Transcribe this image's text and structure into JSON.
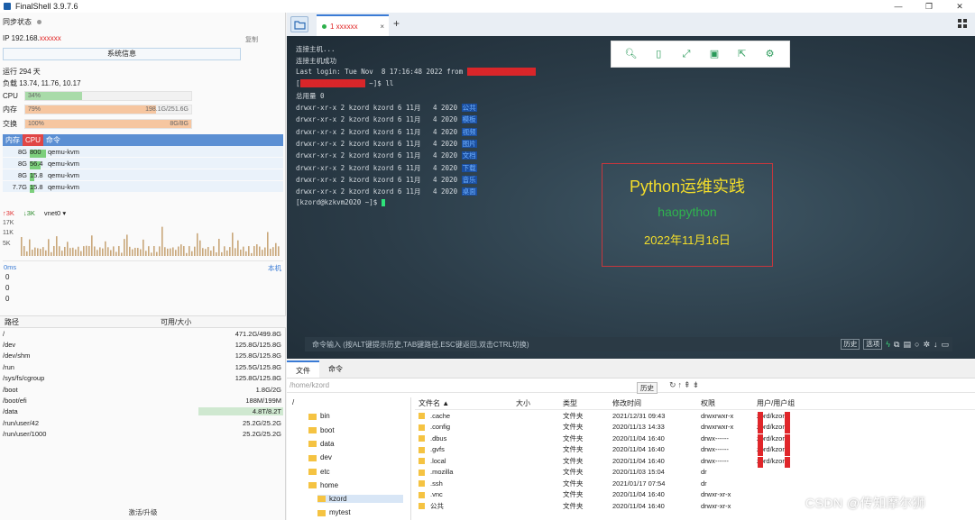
{
  "app": {
    "title": "FinalShell 3.9.7.6",
    "window_buttons": [
      "—",
      "❐",
      "✕"
    ]
  },
  "left": {
    "sync_label": "同步状态",
    "ip_prefix": "IP 192.168.",
    "ip_redacted": "xxxxxx",
    "copy_label": "复制",
    "sysinfo_label": "系统信息",
    "uptime": "运行 294 天",
    "load": "负载 13.74, 11.76, 10.17",
    "cpu": {
      "label": "CPU",
      "pct": "34%",
      "fraction": 0.34,
      "value": "",
      "color": "#a9dba9"
    },
    "mem": {
      "label": "内存",
      "pct": "79%",
      "fraction": 0.79,
      "value": "198.1G/251.6G",
      "color": "#f6c6a0"
    },
    "swap": {
      "label": "交换",
      "pct": "100%",
      "fraction": 1.0,
      "value": "8G/8G",
      "color": "#f6c6a0"
    },
    "proc_header": {
      "mem": "内存",
      "cpu": "CPU",
      "cmd": "命令"
    },
    "processes": [
      {
        "mem": "8G",
        "cpu": "800",
        "cpu_fraction": 1.0,
        "cmd": "qemu-kvm"
      },
      {
        "mem": "8G",
        "cpu": "56.4",
        "cpu_fraction": 0.65,
        "cmd": "qemu-kvm"
      },
      {
        "mem": "8G",
        "cpu": "15.8",
        "cpu_fraction": 0.3,
        "cmd": "qemu-kvm"
      },
      {
        "mem": "7.7G",
        "cpu": "15.8",
        "cpu_fraction": 0.3,
        "cmd": "qemu-kvm"
      }
    ],
    "net": {
      "up": "3K",
      "down": "3K",
      "iface": "vnet0",
      "y_labels": [
        "17K",
        "11K",
        "5K"
      ]
    },
    "ping": {
      "ms_label": "0ms",
      "local_label": "本机",
      "values": [
        "0",
        "0",
        "0"
      ]
    },
    "disk_header": {
      "path": "路径",
      "size": "可用/大小"
    },
    "disks": [
      {
        "path": "/",
        "size": "471.2G/499.8G",
        "hl": false
      },
      {
        "path": "/dev",
        "size": "125.8G/125.8G",
        "hl": false
      },
      {
        "path": "/dev/shm",
        "size": "125.8G/125.8G",
        "hl": false
      },
      {
        "path": "/run",
        "size": "125.5G/125.8G",
        "hl": false
      },
      {
        "path": "/sys/fs/cgroup",
        "size": "125.8G/125.8G",
        "hl": false
      },
      {
        "path": "/boot",
        "size": "1.8G/2G",
        "hl": false
      },
      {
        "path": "/boot/efi",
        "size": "188M/199M",
        "hl": false
      },
      {
        "path": "/data",
        "size": "4.8T/8.2T",
        "hl": true
      },
      {
        "path": "/run/user/42",
        "size": "25.2G/25.2G",
        "hl": false
      },
      {
        "path": "/run/user/1000",
        "size": "25.2G/25.2G",
        "hl": false
      }
    ],
    "activate_label": "激活/升级"
  },
  "tabs": {
    "active_name": "1 xxxxxx",
    "close": "×",
    "add": "+"
  },
  "terminal": {
    "lines": [
      "连接主机...",
      "连接主机成功",
      "Last login: Tue Nov  8 17:16:48 2022 from ",
      "~]$ ll",
      "总用量 0"
    ],
    "dir_entries": [
      {
        "perm": "drwxr-xr-x 2 kzord kzord 6 11月   4 2020",
        "name": "公共"
      },
      {
        "perm": "drwxr-xr-x 2 kzord kzord 6 11月   4 2020",
        "name": "模板"
      },
      {
        "perm": "drwxr-xr-x 2 kzord kzord 6 11月   4 2020",
        "name": "视频"
      },
      {
        "perm": "drwxr-xr-x 2 kzord kzord 6 11月   4 2020",
        "name": "图片"
      },
      {
        "perm": "drwxr-xr-x 2 kzord kzord 6 11月   4 2020",
        "name": "文档"
      },
      {
        "perm": "drwxr-xr-x 2 kzord kzord 6 11月   4 2020",
        "name": "下载"
      },
      {
        "perm": "drwxr-xr-x 2 kzord kzord 6 11月   4 2020",
        "name": "音乐"
      },
      {
        "perm": "drwxr-xr-x 2 kzord kzord 6 11月   4 2020",
        "name": "桌面"
      }
    ],
    "prompt": "[kzord@kzkvm2020 ~]$ ",
    "toolbar_icons": [
      "search-icon",
      "copy-icon",
      "fullscreen-icon",
      "save-icon",
      "export-icon",
      "settings-icon"
    ],
    "banner": {
      "line1": "Python运维实践",
      "line2": "haopython",
      "line3": "2022年11月16日"
    },
    "cmd_placeholder": "命令输入 (按ALT键提示历史,TAB键路径,ESC键返回,双击CTRL切换)",
    "history_btn": "历史",
    "select_btn": "选项"
  },
  "files": {
    "tabs": [
      "文件",
      "命令"
    ],
    "path": "/home/kzord",
    "history_btn": "历史",
    "tree": [
      {
        "name": "/",
        "level": 0
      },
      {
        "name": "bin",
        "level": 1
      },
      {
        "name": "boot",
        "level": 1
      },
      {
        "name": "data",
        "level": 1
      },
      {
        "name": "dev",
        "level": 1
      },
      {
        "name": "etc",
        "level": 1
      },
      {
        "name": "home",
        "level": 1
      },
      {
        "name": "kzord",
        "level": 2
      },
      {
        "name": "mytest",
        "level": 2
      }
    ],
    "columns": [
      "文件名 ▲",
      "大小",
      "类型",
      "修改时间",
      "权限",
      "用户/用户组"
    ],
    "rows": [
      {
        "name": ".cache",
        "size": "",
        "type": "文件夹",
        "mtime": "2021/12/31 09:43",
        "perm": "drwxrwxr-x",
        "owner": "zord/kzord"
      },
      {
        "name": ".config",
        "size": "",
        "type": "文件夹",
        "mtime": "2020/11/13 14:33",
        "perm": "drwxrwxr-x",
        "owner": "zord/kzord"
      },
      {
        "name": ".dbus",
        "size": "",
        "type": "文件夹",
        "mtime": "2020/11/04 16:40",
        "perm": "drwx------",
        "owner": "zord/kzord"
      },
      {
        "name": ".gvfs",
        "size": "",
        "type": "文件夹",
        "mtime": "2020/11/04 16:40",
        "perm": "drwx------",
        "owner": "zord/kzord"
      },
      {
        "name": ".local",
        "size": "",
        "type": "文件夹",
        "mtime": "2020/11/04 16:40",
        "perm": "drwx------",
        "owner": "zord/kzord"
      },
      {
        "name": ".mozilla",
        "size": "",
        "type": "文件夹",
        "mtime": "2020/11/03 15:04",
        "perm": "dr",
        "owner": ""
      },
      {
        "name": ".ssh",
        "size": "",
        "type": "文件夹",
        "mtime": "2021/01/17 07:54",
        "perm": "dr",
        "owner": ""
      },
      {
        "name": ".vnc",
        "size": "",
        "type": "文件夹",
        "mtime": "2020/11/04 16:40",
        "perm": "drwxr-xr-x",
        "owner": ""
      },
      {
        "name": "公共",
        "size": "",
        "type": "文件夹",
        "mtime": "2020/11/04 16:40",
        "perm": "drwxr-xr-x",
        "owner": ""
      }
    ]
  },
  "watermark": "CSDN @传知摩尔狮"
}
